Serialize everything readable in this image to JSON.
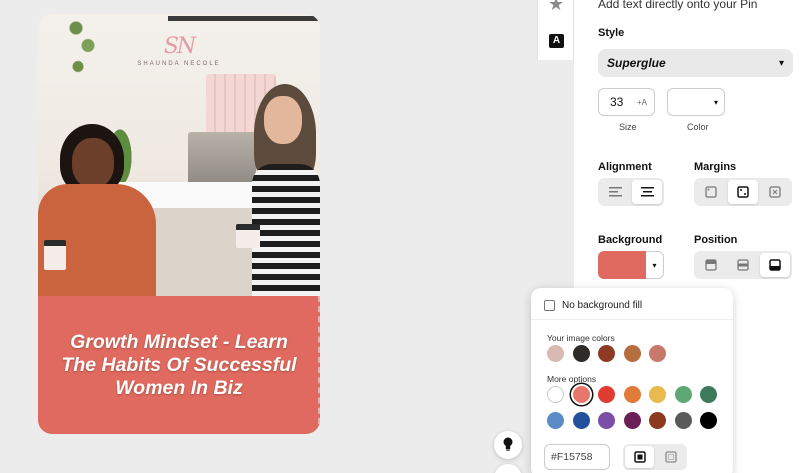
{
  "pin": {
    "brand_mark": "SN",
    "brand_name": "SHAUNDA NECOLE",
    "title": "Growth Mindset - Learn The Habits Of Successful Women In Biz",
    "band_color": "#E06A5F"
  },
  "toolbar": {
    "tools": [
      "star-icon",
      "text-tool-icon"
    ],
    "text_tool_glyph": "A"
  },
  "panel": {
    "hint": "Add text directly onto your Pin",
    "style_label": "Style",
    "style_value": "Superglue",
    "size_value": "33",
    "size_icon": "+A",
    "size_label": "Size",
    "color_label": "Color",
    "alignment_label": "Alignment",
    "margins_label": "Margins",
    "background_label": "Background",
    "position_label": "Position",
    "background_color": "#E06A5F"
  },
  "popover": {
    "no_bg_label": "No background fill",
    "image_colors_label": "Your image colors",
    "image_colors": [
      "#D9BAB3",
      "#2E2A27",
      "#8E3B25",
      "#B76E3F",
      "#C77A6B"
    ],
    "more_options_label": "More options",
    "more_row1": [
      "#FFFFFF",
      "#E7776C",
      "#E03C31",
      "#E07B39",
      "#E9BB4F",
      "#5FA774",
      "#3C7A5B"
    ],
    "more_row2": [
      "#5B8CC8",
      "#23519C",
      "#7B4EA8",
      "#6C1E57",
      "#8B3A1E",
      "#5A5A5A",
      "#000000"
    ],
    "selected_color": "#E7776C",
    "hex_value": "#F15758"
  }
}
